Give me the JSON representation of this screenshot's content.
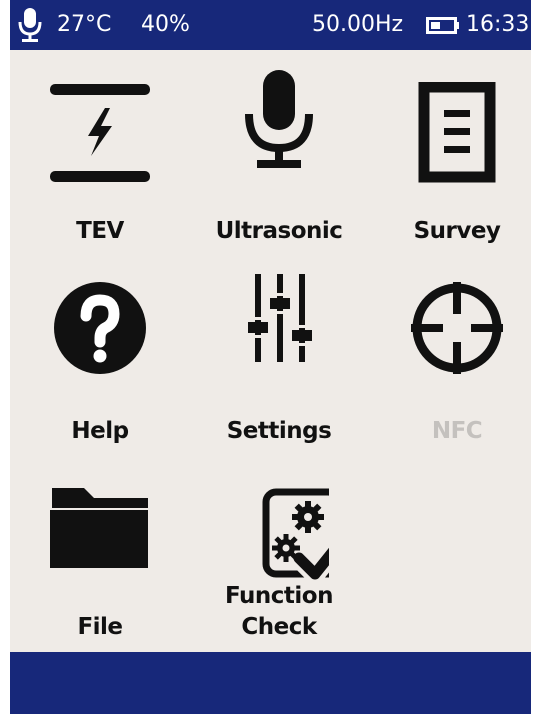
{
  "status_bar": {
    "mic_icon": "microphone-icon",
    "temperature": "27°C",
    "humidity": "40%",
    "frequency": "50.00Hz",
    "battery_icon": "battery-icon",
    "time": "16:33"
  },
  "menu": [
    {
      "id": "tev",
      "label": "TEV",
      "icon": "tev-icon",
      "enabled": true
    },
    {
      "id": "ultrasonic",
      "label": "Ultrasonic",
      "icon": "microphone-icon",
      "enabled": true
    },
    {
      "id": "survey",
      "label": "Survey",
      "icon": "document-icon",
      "enabled": true
    },
    {
      "id": "help",
      "label": "Help",
      "icon": "question-icon",
      "enabled": true
    },
    {
      "id": "settings",
      "label": "Settings",
      "icon": "sliders-icon",
      "enabled": true
    },
    {
      "id": "nfc",
      "label": "NFC",
      "icon": "crosshair-icon",
      "enabled": false
    },
    {
      "id": "file",
      "label": "File",
      "icon": "folder-icon",
      "enabled": true
    },
    {
      "id": "function-check",
      "label_line1": "Function",
      "label_line2": "Check",
      "icon": "gear-check-icon",
      "enabled": true
    }
  ],
  "colors": {
    "bar_background": "#17287a",
    "screen_background": "#efebe7",
    "icon": "#111111",
    "disabled_text": "#c4c1be"
  }
}
